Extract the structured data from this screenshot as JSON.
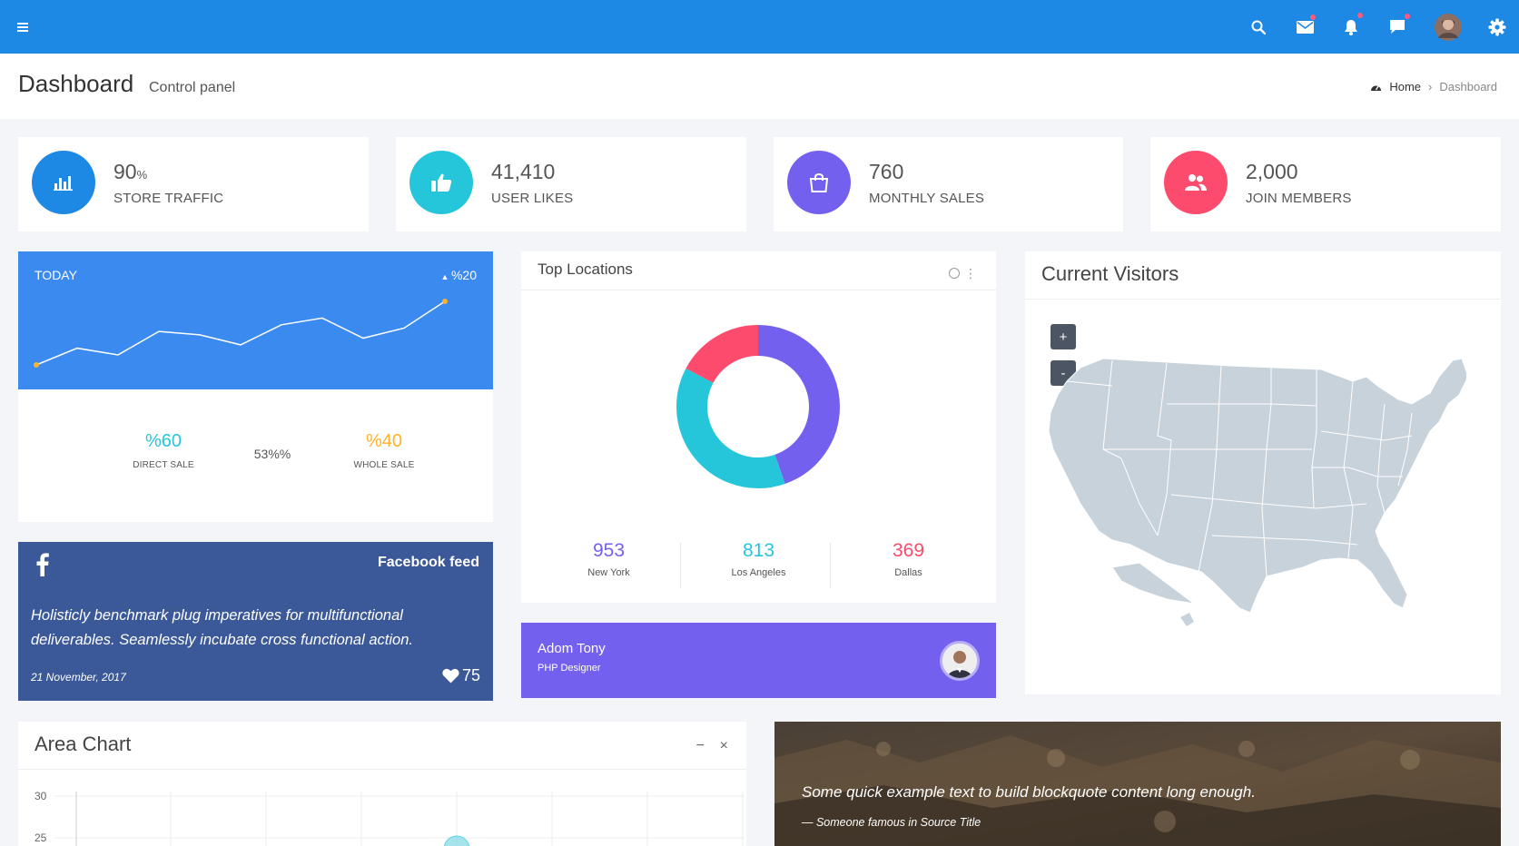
{
  "topbar": {
    "icons": [
      "hamburger-icon",
      "search-icon",
      "mail-icon",
      "bell-icon",
      "chat-icon",
      "user-avatar",
      "gear-icon"
    ],
    "brand_color": "#1e88e5"
  },
  "header": {
    "title": "Dashboard",
    "subtitle": "Control panel",
    "breadcrumb": {
      "home": "Home",
      "current": "Dashboard"
    }
  },
  "stats": [
    {
      "value": "90",
      "unit": "%",
      "label": "STORE TRAFFIC",
      "color": "#1e88e5",
      "icon": "bar-chart-icon"
    },
    {
      "value": "41,410",
      "unit": "",
      "label": "USER LIKES",
      "color": "#26c6da",
      "icon": "thumbs-up-icon"
    },
    {
      "value": "760",
      "unit": "",
      "label": "MONTHLY SALES",
      "color": "#7460ee",
      "icon": "shopping-bag-icon"
    },
    {
      "value": "2,000",
      "unit": "",
      "label": "JOIN MEMBERS",
      "color": "#fc4b6c",
      "icon": "users-icon"
    }
  ],
  "today": {
    "title": "TODAY",
    "change": "%20",
    "direct": {
      "value": "%60",
      "label": "DIRECT SALE",
      "color": "#26c6da"
    },
    "middle": "53%%",
    "whole": {
      "value": "%40",
      "label": "WHOLE SALE",
      "color": "#ffb22b"
    }
  },
  "today_chart_data": {
    "type": "line",
    "values": [
      3,
      8,
      6,
      13,
      12,
      9,
      15,
      17,
      11,
      14,
      22
    ]
  },
  "facebook": {
    "title": "Facebook feed",
    "text": "Holisticly benchmark plug imperatives for multifunctional deliverables. Seamlessly incubate cross functional action.",
    "date": "21 November, 2017",
    "likes": "75"
  },
  "top_locations": {
    "title": "Top Locations",
    "items": [
      {
        "value": "953",
        "label": "New York",
        "color": "#7460ee"
      },
      {
        "value": "813",
        "label": "Los Angeles",
        "color": "#26c6da"
      },
      {
        "value": "369",
        "label": "Dallas",
        "color": "#fc4b6c"
      }
    ]
  },
  "donut_data": {
    "type": "pie",
    "values": [
      953,
      813,
      369
    ],
    "colors": [
      "#7460ee",
      "#26c6da",
      "#fc4b6c"
    ]
  },
  "profile": {
    "name": "Adom Tony",
    "role": "PHP Designer"
  },
  "visitors": {
    "title": "Current Visitors",
    "zoom_in": "+",
    "zoom_out": "-"
  },
  "area_chart": {
    "title": "Area Chart",
    "min_label": "−",
    "close_label": "×",
    "y_ticks": [
      "30",
      "25"
    ]
  },
  "quote": {
    "text": "Some quick example text to build blockquote content long enough.",
    "source": "— Someone famous in Source Title"
  }
}
